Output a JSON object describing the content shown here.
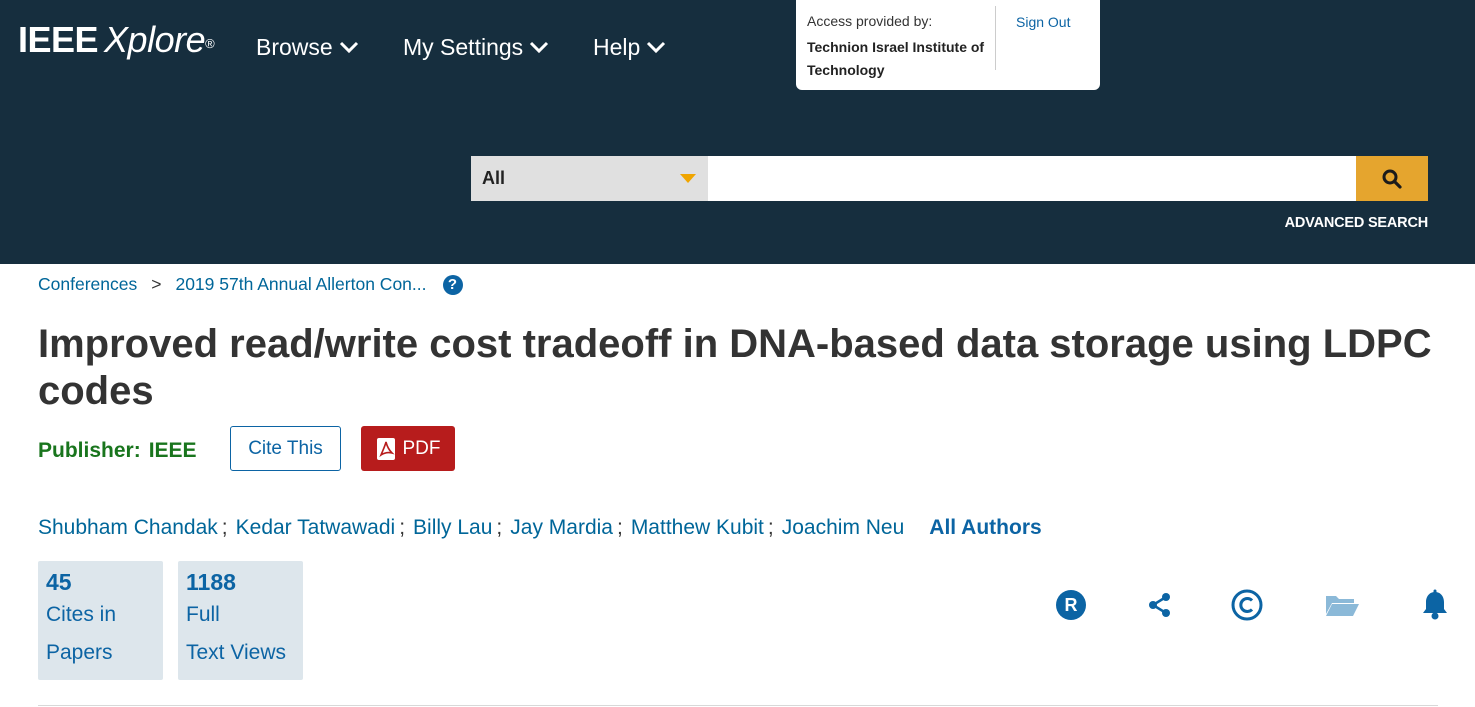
{
  "header": {
    "logo_main": "IEEE",
    "logo_sub": "Xplore",
    "logo_mark": "®",
    "nav": [
      "Browse",
      "My Settings",
      "Help"
    ],
    "access": {
      "label": "Access provided by:",
      "institution": "Technion Israel Institute of Technology",
      "sign_out": "Sign Out"
    },
    "search": {
      "scope": "All",
      "value": "",
      "placeholder": "",
      "advanced": "ADVANCED SEARCH"
    }
  },
  "breadcrumb": {
    "items": [
      "Conferences",
      "2019 57th Annual Allerton Con..."
    ],
    "separator": ">",
    "help_glyph": "?"
  },
  "article": {
    "title": "Improved read/write cost tradeoff in DNA-based data storage using LDPC codes",
    "publisher_label": "Publisher:",
    "publisher_value": "IEEE",
    "cite_label": "Cite This",
    "pdf_label": "PDF",
    "authors": [
      "Shubham Chandak",
      "Kedar Tatwawadi",
      "Billy Lau",
      "Jay Mardia",
      "Matthew Kubit",
      "Joachim Neu"
    ],
    "author_sep": ";",
    "all_authors": "All Authors",
    "metrics": [
      {
        "value": "45",
        "line1": "Cites in",
        "line2": "Papers"
      },
      {
        "value": "1188",
        "line1": "Full",
        "line2": "Text Views"
      }
    ]
  },
  "icons": [
    "rights-icon",
    "share-icon",
    "copyright-icon",
    "folder-icon",
    "bell-icon"
  ],
  "colors": {
    "header_bg": "#162e3e",
    "search_btn": "#e5a52e",
    "link": "#006699",
    "publisher": "#19751d",
    "pdf": "#b71c1c"
  }
}
